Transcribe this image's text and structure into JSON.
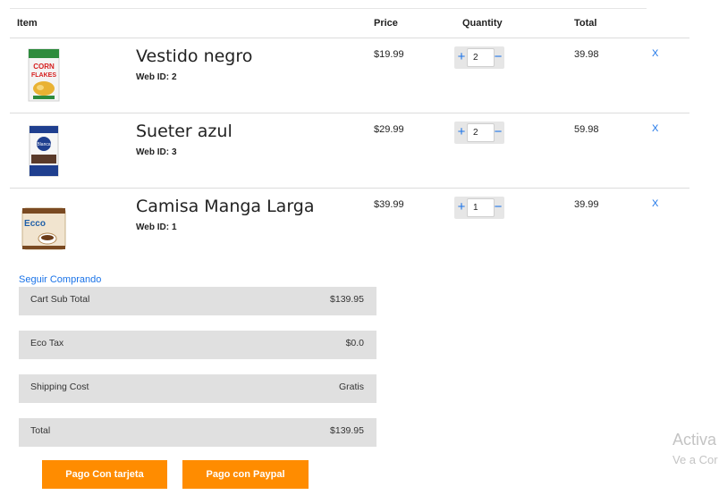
{
  "table": {
    "headers": {
      "item": "Item",
      "price": "Price",
      "quantity": "Quantity",
      "total": "Total"
    }
  },
  "cart": {
    "items": [
      {
        "name": "Vestido negro",
        "web_id_label": "Web ID:",
        "web_id": "2",
        "price": "$19.99",
        "quantity": "2",
        "total": "39.98",
        "remove": "X",
        "image_icon": "cereal-box-image"
      },
      {
        "name": "Sueter azul",
        "web_id_label": "Web ID:",
        "web_id": "3",
        "price": "$29.99",
        "quantity": "2",
        "total": "59.98",
        "remove": "X",
        "image_icon": "milk-powder-box-image"
      },
      {
        "name": "Camisa Manga Larga",
        "web_id_label": "Web ID:",
        "web_id": "1",
        "price": "$39.99",
        "quantity": "1",
        "total": "39.99",
        "remove": "X",
        "image_icon": "coffee-can-image"
      }
    ],
    "qty_plus": "+",
    "qty_minus": "−"
  },
  "continue_link": "Seguir Comprando",
  "summary": {
    "subtotal_label": "Cart Sub Total",
    "subtotal_value": "$139.95",
    "tax_label": "Eco Tax",
    "tax_value": "$0.0",
    "shipping_label": "Shipping Cost",
    "shipping_value": "Gratis",
    "total_label": "Total",
    "total_value": "$139.95"
  },
  "buttons": {
    "card": "Pago Con tarjeta",
    "paypal": "Pago con Paypal"
  },
  "watermark": {
    "line1": "Activa",
    "line2": "Ve a Cor"
  },
  "colors": {
    "accent": "#ff8c00",
    "link": "#1a73e8",
    "summary_bg": "#e0e0e0"
  }
}
